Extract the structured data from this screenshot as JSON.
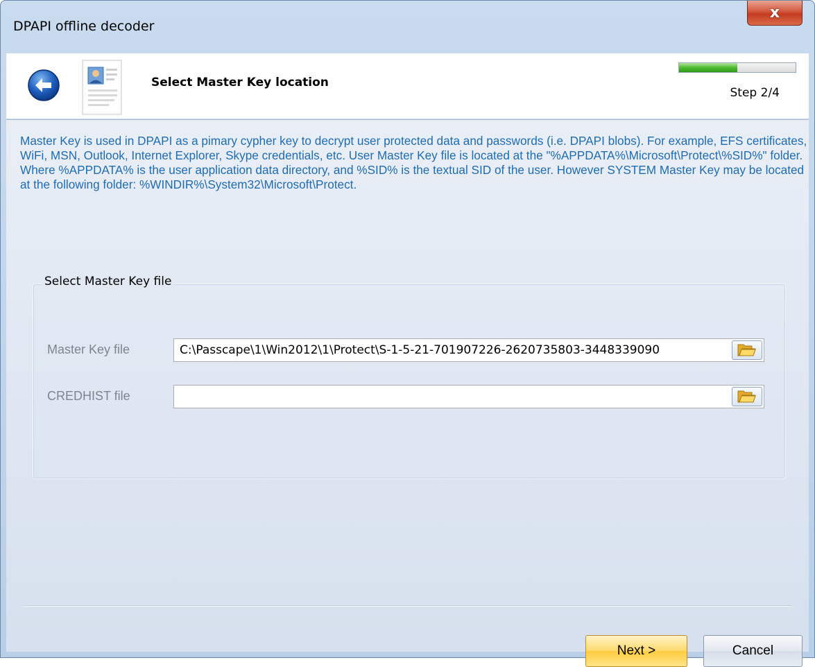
{
  "window": {
    "title": "DPAPI offline decoder",
    "close_label": "x"
  },
  "header": {
    "title": "Select Master Key location",
    "step_label": "Step 2/4",
    "progress_fraction": 0.5,
    "back_icon": "back-arrow-icon",
    "page_icon": "document-user-icon"
  },
  "main": {
    "description": "Master Key is used in DPAPI as a pimary cypher key to decrypt user protected data and passwords (i.e. DPAPI blobs). For example, EFS certificates, WiFi, MSN, Outlook, Internet Explorer, Skype credentials, etc. User Master Key file is located at the \"%APPDATA%\\Microsoft\\Protect\\%SID%\" folder. Where %APPDATA% is the user application data directory, and %SID% is the textual SID of the user. However SYSTEM Master Key may be located at the following folder: %WINDIR%\\System32\\Microsoft\\Protect.",
    "group": {
      "title": "Select Master Key file",
      "master_key_label": "Master Key file",
      "master_key_value": "C:\\Passcape\\1\\Win2012\\1\\Protect\\S-1-5-21-701907226-2620735803-3448339090",
      "credhist_label": "CREDHIST file",
      "credhist_value": ""
    }
  },
  "footer": {
    "next_label": "Next >",
    "cancel_label": "Cancel"
  },
  "colors": {
    "description_text": "#1f6cae",
    "next_button": "#ffd86b",
    "progress_fill": "#4dbb2e"
  }
}
